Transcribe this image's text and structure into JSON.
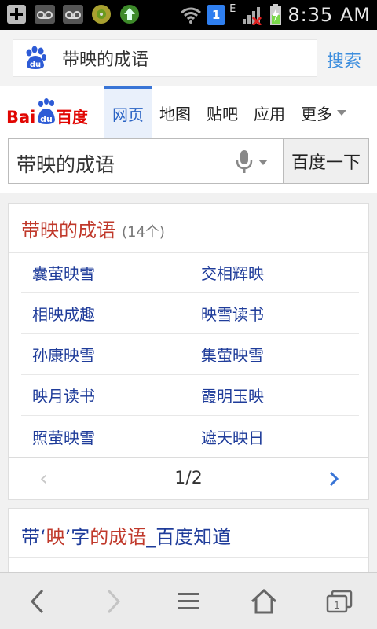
{
  "status_bar": {
    "time": "8:35 AM",
    "sim_number": "1",
    "network_type": "E",
    "icons": [
      "add-icon",
      "voicemail-icon",
      "voicemail-icon",
      "app-icon",
      "upload-icon",
      "wifi-icon",
      "signal-icon",
      "battery-icon"
    ]
  },
  "address_bar": {
    "query": "带映的成语",
    "search_label": "搜索"
  },
  "nav": {
    "logo_text": "Baidu百度",
    "tabs": [
      {
        "label": "网页",
        "active": true
      },
      {
        "label": "地图",
        "active": false
      },
      {
        "label": "贴吧",
        "active": false
      },
      {
        "label": "应用",
        "active": false
      },
      {
        "label": "更多",
        "active": false
      }
    ]
  },
  "search_box": {
    "value": "带映的成语",
    "button_label": "百度一下"
  },
  "idiom_card": {
    "title": "带映的成语",
    "count": "(14个)",
    "rows": [
      [
        "囊萤映雪",
        "交相辉映"
      ],
      [
        "相映成趣",
        "映雪读书"
      ],
      [
        "孙康映雪",
        "集萤映雪"
      ],
      [
        "映月读书",
        "霞明玉映"
      ],
      [
        "照萤映雪",
        "遮天映日"
      ]
    ],
    "pager": {
      "prev": "‹",
      "page": "1/2",
      "next": "›"
    }
  },
  "result2": {
    "title_part1": "带‘",
    "title_hl1": "映",
    "title_part2": "’字",
    "title_hl2": "的成语",
    "title_part3": "_百度知道"
  },
  "colors": {
    "link_blue": "#1f3c9a",
    "accent_red": "#c0392b",
    "tab_active_blue": "#2a63c4",
    "search_link": "#3d8ede"
  }
}
